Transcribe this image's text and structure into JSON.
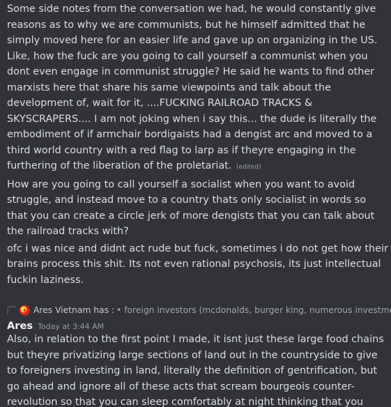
{
  "messages_first": [
    {
      "text": "Some side notes from the conversation we had, he would constantly give reasons as to why we are communists, but he himself admitted that he simply moved here for an easier life and gave up on organizing in the US. Like, how the fuck are you going to call yourself a communist when you dont even engage in communist struggle? He said he wants to find other marxists here that share his same viewpoints and talk about the development of, wait for it, ....FUCKING RAILROAD TRACKS & SKYSCRAPERS.... I am not joking when i say this... the dude is literally the embodiment of if armchair bordigaists had a dengist arc and moved to a third world country with a red flag to larp as if theyre engaging in the furthering of the liberation of the proletariat.",
      "edited_label": "(edited)"
    },
    {
      "text": "How are you going to call yourself a socialist when you want to avoid struggle, and instead move to a country thats only socialist in words so that you can create a circle jerk of more dengists that you can talk about the railroad tracks with?"
    },
    {
      "text": "ofc i was nice and didnt act rude but fuck, sometimes i do not get how their brains process this shit. Its not even rational psychosis, its just intellectual fuckin laziness."
    }
  ],
  "reply": {
    "author": "Ares Vietnam has :",
    "preview": "• foreign investors (mcdonalds, burger king, numerous investments fro",
    "avatar_icon": "vietnam-flag-avatar-icon"
  },
  "message_second": {
    "author": "Ares",
    "timestamp": "Today at 3:44 AM",
    "text": "Also, in relation to the first point I made, it isnt just these large food chains but theyre privatizing large sections of land out in the countryside to give to foreigners investing in land, literally the definition of gentrification, but go ahead and ignore all of these acts that scream bourgeois counter-revolution so that you can sleep comfortably at night thinking that you finally live under socialism"
  },
  "colors": {
    "background": "#313338",
    "text": "#dbdee1",
    "author": "#f2f3f5",
    "muted": "#949ba4"
  }
}
